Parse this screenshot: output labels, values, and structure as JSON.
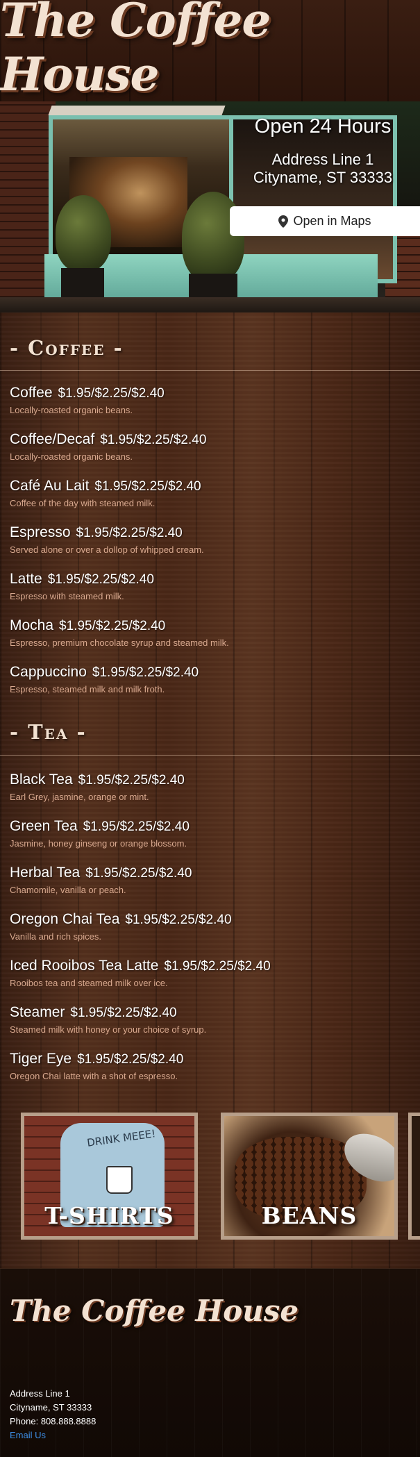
{
  "header": {
    "logo_text": "The Coffee House"
  },
  "hero": {
    "hours": "Open 24 Hours",
    "address_line1": "Address Line 1",
    "address_line2": "Cityname, ST 33333",
    "maps_button_label": "Open in Maps",
    "maps_icon": "map-pin-icon"
  },
  "menu": {
    "coffee": {
      "title": "- Coffee -",
      "items": [
        {
          "name": "Coffee",
          "price": "$1.95/$2.25/$2.40",
          "desc": "Locally-roasted organic beans."
        },
        {
          "name": "Coffee/Decaf",
          "price": "$1.95/$2.25/$2.40",
          "desc": "Locally-roasted organic beans."
        },
        {
          "name": "Café Au Lait",
          "price": "$1.95/$2.25/$2.40",
          "desc": "Coffee of the day with steamed milk."
        },
        {
          "name": "Espresso",
          "price": "$1.95/$2.25/$2.40",
          "desc": "Served alone or over a dollop of whipped cream."
        },
        {
          "name": "Latte",
          "price": "$1.95/$2.25/$2.40",
          "desc": "Espresso with steamed milk."
        },
        {
          "name": "Mocha",
          "price": "$1.95/$2.25/$2.40",
          "desc": "Espresso, premium chocolate syrup and steamed milk."
        },
        {
          "name": "Cappuccino",
          "price": "$1.95/$2.25/$2.40",
          "desc": "Espresso, steamed milk and milk froth."
        }
      ]
    },
    "tea": {
      "title": "- Tea -",
      "items": [
        {
          "name": "Black Tea",
          "price": "$1.95/$2.25/$2.40",
          "desc": "Earl Grey, jasmine, orange or mint."
        },
        {
          "name": "Green Tea",
          "price": "$1.95/$2.25/$2.40",
          "desc": "Jasmine, honey ginseng or orange blossom."
        },
        {
          "name": "Herbal Tea",
          "price": "$1.95/$2.25/$2.40",
          "desc": "Chamomile, vanilla or peach."
        },
        {
          "name": "Oregon Chai Tea",
          "price": "$1.95/$2.25/$2.40",
          "desc": "Vanilla and rich spices."
        },
        {
          "name": "Iced Rooibos Tea Latte",
          "price": "$1.95/$2.25/$2.40",
          "desc": "Rooibos tea and steamed milk over ice."
        },
        {
          "name": "Steamer",
          "price": "$1.95/$2.25/$2.40",
          "desc": "Steamed milk with honey or your choice of syrup."
        },
        {
          "name": "Tiger Eye",
          "price": "$1.95/$2.25/$2.40",
          "desc": "Oregon Chai latte with a shot of espresso."
        }
      ]
    }
  },
  "tiles": {
    "tshirts_label": "T-SHIRTS",
    "tshirt_print": "DRINK MEEE!",
    "beans_label": "BEANS"
  },
  "footer": {
    "logo_text": "The Coffee House",
    "address_line1": "Address Line 1",
    "address_line2": "Cityname, ST 33333",
    "phone": "Phone: 808.888.8888",
    "email_link": "Email Us"
  },
  "colors": {
    "link": "#3d8fe6",
    "desc_text": "#d9a98f",
    "accent_trim": "#79bfae"
  }
}
